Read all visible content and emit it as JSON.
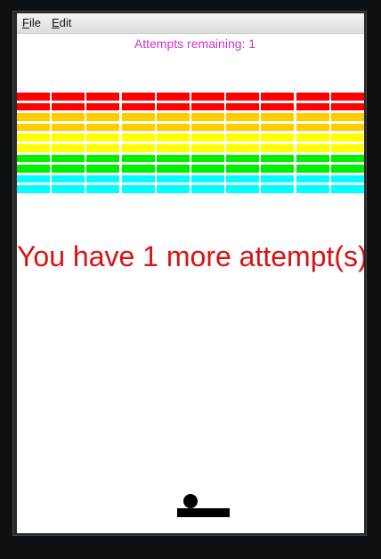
{
  "menu": {
    "file_label": "File",
    "file_rest": "ile",
    "file_mnemonic": "F",
    "edit_mnemonic": "E",
    "edit_rest": "dit"
  },
  "status": {
    "attempts_text": "Attempts remaining: 1"
  },
  "message": {
    "text": "You have 1 more attempt(s)"
  },
  "colors": {
    "attempts_text": "#cc33cc",
    "message_text": "#dd1111",
    "brick_rows": [
      "#ff0000",
      "#ff0000",
      "#ffcc00",
      "#ffcc00",
      "#ffff00",
      "#ffff00",
      "#00ee00",
      "#00ee00",
      "#00ffff",
      "#00ffff"
    ],
    "paddle": "#000000",
    "ball": "#000000"
  },
  "game": {
    "brick_rows": 10,
    "brick_cols": 10
  }
}
